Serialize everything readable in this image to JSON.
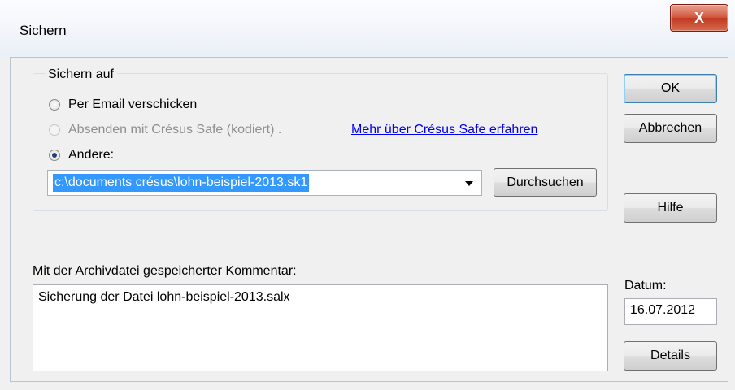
{
  "window": {
    "title": "Sichern",
    "close_glyph": "X"
  },
  "backup_group": {
    "label": "Sichern auf",
    "options": [
      {
        "label": "Per Email verschicken",
        "selected": false,
        "enabled": true
      },
      {
        "label": "Absenden mit Crésus Safe (kodiert) .",
        "selected": false,
        "enabled": false
      },
      {
        "label": "Andere:",
        "selected": true,
        "enabled": true
      }
    ],
    "link_text": "Mehr über Crésus Safe erfahren",
    "path_value": "c:\\documents crésus\\lohn-beispiel-2013.sk1",
    "browse_label": "Durchsuchen"
  },
  "comment": {
    "label": "Mit der Archivdatei gespeicherter Kommentar:",
    "value": "Sicherung der Datei lohn-beispiel-2013.salx"
  },
  "date": {
    "label": "Datum:",
    "value": "16.07.2012"
  },
  "buttons": {
    "ok": "OK",
    "cancel": "Abbrechen",
    "help": "Hilfe",
    "details": "Details"
  }
}
